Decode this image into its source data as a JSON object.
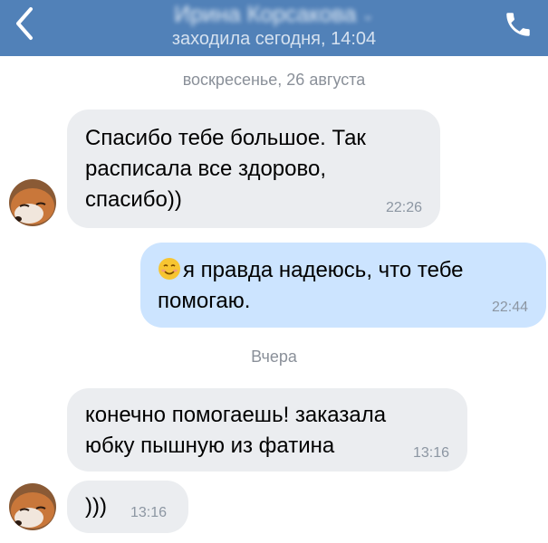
{
  "header": {
    "contact_name": "Ирина Корсакова",
    "status": "заходила сегодня, 14:04",
    "back_icon": "chevron-left-icon",
    "call_icon": "phone-icon",
    "background": "#5181b8"
  },
  "chat": {
    "date_sunday": "воскресенье, 26 августа",
    "date_yesterday": "Вчера",
    "messages": [
      {
        "direction": "in",
        "lines": [
          "Спасибо тебе большое. Так",
          "расписала все здорово,",
          "спасибо))"
        ],
        "time": "22:26"
      },
      {
        "direction": "out",
        "emoji": "smiling-face-emoji",
        "lines": [
          "я правда надеюсь, что тебе",
          "помогаю."
        ],
        "time": "22:44"
      },
      {
        "direction": "in",
        "lines": [
          "конечно помогаешь! заказала",
          "юбку пышную из фатина"
        ],
        "time": "13:16"
      },
      {
        "direction": "in",
        "lines": [
          ")))"
        ],
        "time": "13:16"
      }
    ]
  }
}
